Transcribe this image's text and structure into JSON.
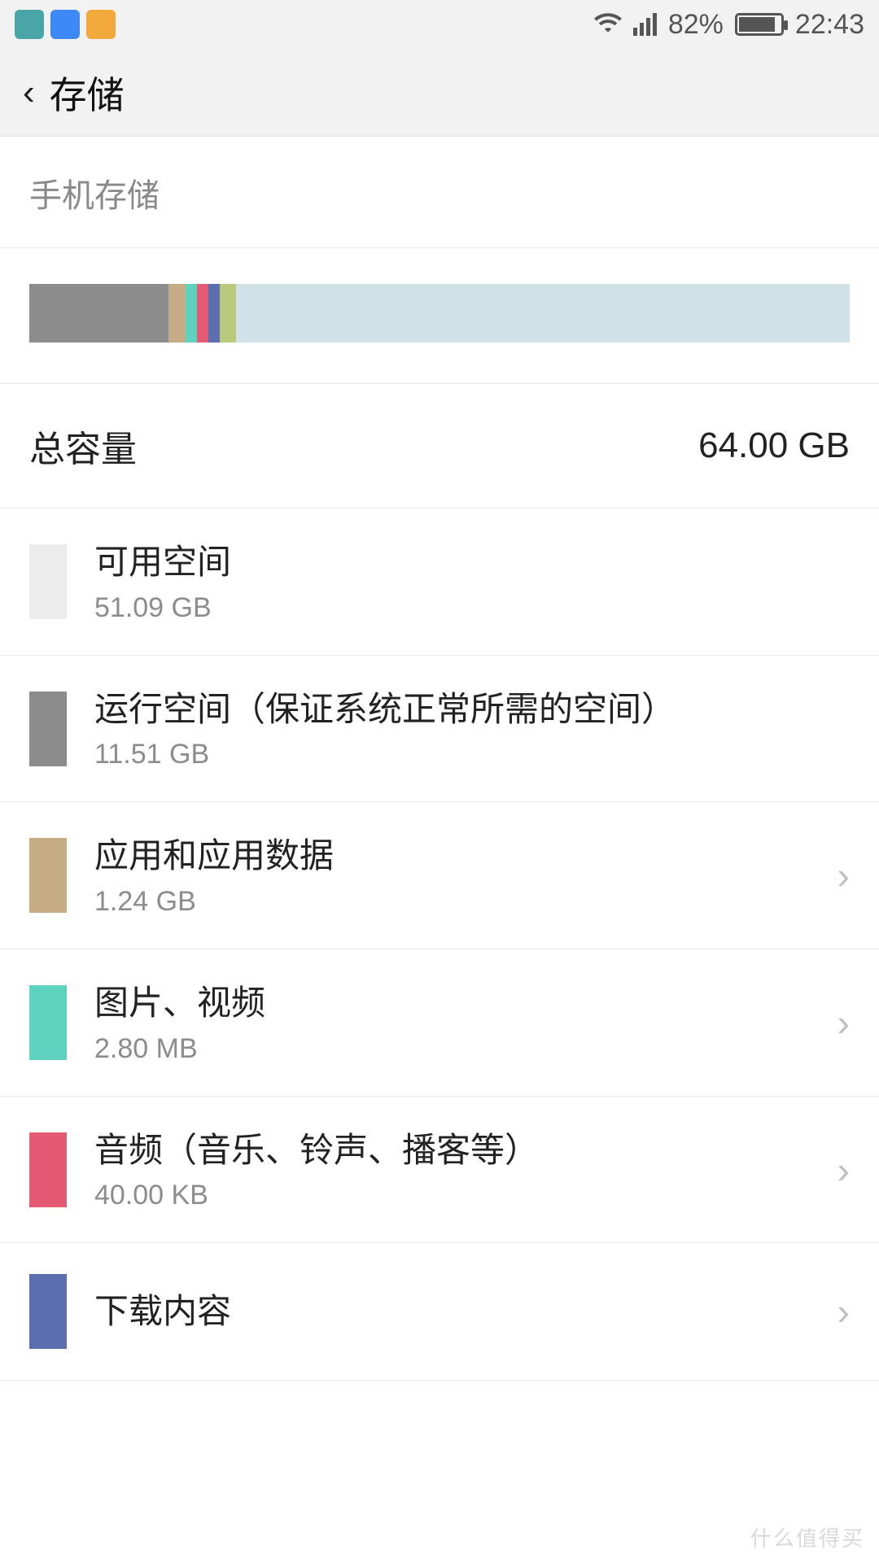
{
  "statusbar": {
    "battery_percent": "82%",
    "time": "22:43",
    "app_icons": [
      {
        "name": "gallery-icon",
        "bg": "#4aa6a6"
      },
      {
        "name": "shield-icon",
        "bg": "#3d8af7"
      },
      {
        "name": "s-icon",
        "bg": "#f2a93c"
      }
    ]
  },
  "header": {
    "title": "存储"
  },
  "section_label": "手机存储",
  "bar_segments": [
    {
      "name": "system",
      "color": "#8c8c8c",
      "width": "17%"
    },
    {
      "name": "apps",
      "color": "#c7ad86",
      "width": "2%"
    },
    {
      "name": "pictures",
      "color": "#5fd1bf",
      "width": "1.4%"
    },
    {
      "name": "audio",
      "color": "#e35a72",
      "width": "1.4%"
    },
    {
      "name": "downloads",
      "color": "#5b6fb0",
      "width": "1.4%"
    },
    {
      "name": "other",
      "color": "#b9c97b",
      "width": "2%"
    },
    {
      "name": "free",
      "color": "#d1e1e8",
      "width": "74.8%"
    }
  ],
  "total": {
    "label": "总容量",
    "value": "64.00 GB"
  },
  "rows": [
    {
      "id": "available",
      "swatch": "#ececec",
      "title": "可用空间",
      "sub": "51.09 GB",
      "nav": false
    },
    {
      "id": "system",
      "swatch": "#8c8c8c",
      "title": "运行空间（保证系统正常所需的空间）",
      "sub": "11.51 GB",
      "nav": false
    },
    {
      "id": "apps",
      "swatch": "#c7ad86",
      "title": "应用和应用数据",
      "sub": "1.24 GB",
      "nav": true
    },
    {
      "id": "pictures",
      "swatch": "#5fd1bf",
      "title": "图片、视频",
      "sub": "2.80 MB",
      "nav": true
    },
    {
      "id": "audio",
      "swatch": "#e35a72",
      "title": "音频（音乐、铃声、播客等）",
      "sub": "40.00 KB",
      "nav": true
    },
    {
      "id": "downloads",
      "swatch": "#5b6fb0",
      "title": "下载内容",
      "sub": "",
      "nav": true
    }
  ],
  "watermark": "什么值得买"
}
